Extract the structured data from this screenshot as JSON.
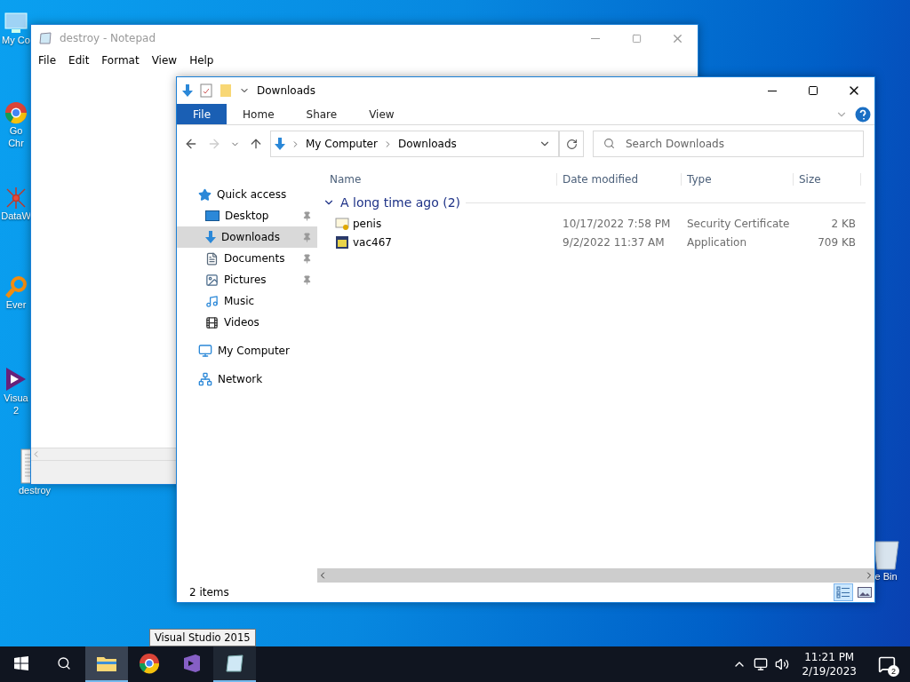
{
  "desktop_icons": [
    {
      "kind": "computer",
      "lines": [
        "My Co"
      ]
    },
    {
      "kind": "chrome",
      "lines": [
        "Go",
        "Chr"
      ]
    },
    {
      "kind": "dataw",
      "lines": [
        "DataW"
      ]
    },
    {
      "kind": "everything",
      "lines": [
        "Ever"
      ]
    },
    {
      "kind": "vs",
      "lines": [
        "Visua",
        "2"
      ]
    },
    {
      "kind": "textfile",
      "lines": [
        "destroy"
      ]
    },
    {
      "kind": "recycle",
      "lines": [
        "e Bin"
      ]
    }
  ],
  "notepad": {
    "title": "destroy - Notepad",
    "menu": [
      "File",
      "Edit",
      "Format",
      "View",
      "Help"
    ]
  },
  "explorer": {
    "title": "Downloads",
    "ribbon_tabs": [
      {
        "label": "File",
        "kind": "menu"
      },
      {
        "label": "Home",
        "kind": "tab"
      },
      {
        "label": "Share",
        "kind": "tab"
      },
      {
        "label": "View",
        "kind": "tab"
      }
    ],
    "breadcrumb": [
      "My Computer",
      "Downloads"
    ],
    "search": {
      "placeholder": "Search Downloads"
    },
    "nav": [
      {
        "label": "Quick access",
        "kind": "star",
        "selected": false,
        "children": [
          {
            "label": "Desktop",
            "kind": "desktop",
            "selected": false,
            "pinned": true
          },
          {
            "label": "Downloads",
            "kind": "download",
            "selected": true,
            "pinned": true
          },
          {
            "label": "Documents",
            "kind": "document",
            "selected": false,
            "pinned": true
          },
          {
            "label": "Pictures",
            "kind": "picture",
            "selected": false,
            "pinned": true
          },
          {
            "label": "Music",
            "kind": "music",
            "selected": false,
            "pinned": false
          },
          {
            "label": "Videos",
            "kind": "video",
            "selected": false,
            "pinned": false
          }
        ]
      },
      {
        "label": "My Computer",
        "kind": "computer",
        "selected": false
      },
      {
        "label": "Network",
        "kind": "network",
        "selected": false
      }
    ],
    "columns": [
      "Name",
      "Date modified",
      "Type",
      "Size"
    ],
    "group": {
      "label": "A long time ago (2)",
      "expanded": true
    },
    "rows": [
      {
        "kind": "certificate",
        "name": "penis",
        "date": "10/17/2022 7:58 PM",
        "type": "Security Certificate",
        "size": "2 KB"
      },
      {
        "kind": "application",
        "name": "vac467",
        "date": "9/2/2022 11:37 AM",
        "type": "Application",
        "size": "709 KB"
      }
    ],
    "status": "2 items",
    "views": [
      {
        "kind": "details",
        "selected": true
      },
      {
        "kind": "large",
        "selected": false
      }
    ]
  },
  "taskbar": {
    "apps": [
      {
        "kind": "explorer",
        "running": true,
        "selected": true
      },
      {
        "kind": "chrome",
        "running": false,
        "selected": false
      },
      {
        "kind": "vs",
        "running": false,
        "selected": false
      },
      {
        "kind": "notepad",
        "running": true,
        "selected": false
      }
    ],
    "tooltip": "Visual Studio 2015",
    "time": "11:21 PM",
    "date": "2/19/2023",
    "notifications": "2"
  }
}
